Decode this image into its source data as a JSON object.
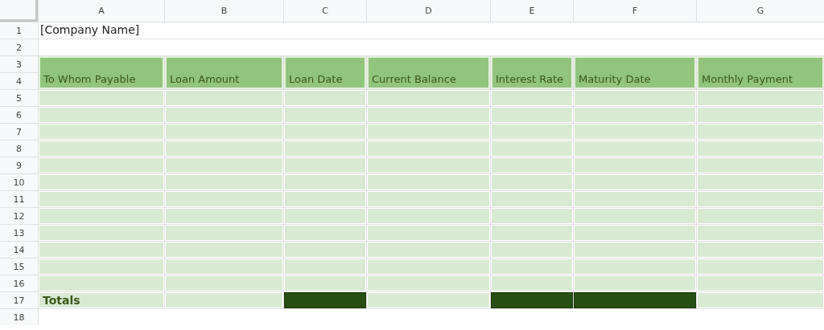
{
  "column_letters": [
    "A",
    "B",
    "C",
    "D",
    "E",
    "F",
    "G"
  ],
  "row_numbers": [
    "1",
    "2",
    "3",
    "4",
    "5",
    "6",
    "7",
    "8",
    "9",
    "10",
    "11",
    "12",
    "13",
    "14",
    "15",
    "16",
    "17",
    "18"
  ],
  "title": "[Company Name]",
  "table": {
    "columns": [
      "To Whom Payable",
      "Loan Amount",
      "Loan Date",
      "Current Balance",
      "Interest Rate",
      "Maturity Date",
      "Monthly Payment"
    ],
    "totals": {
      "label": "Totals",
      "cells": [
        {
          "kind": "light"
        },
        {
          "kind": "dark"
        },
        {
          "kind": "light"
        },
        {
          "kind": "dark"
        },
        {
          "kind": "dark"
        },
        {
          "kind": "light"
        }
      ]
    }
  }
}
